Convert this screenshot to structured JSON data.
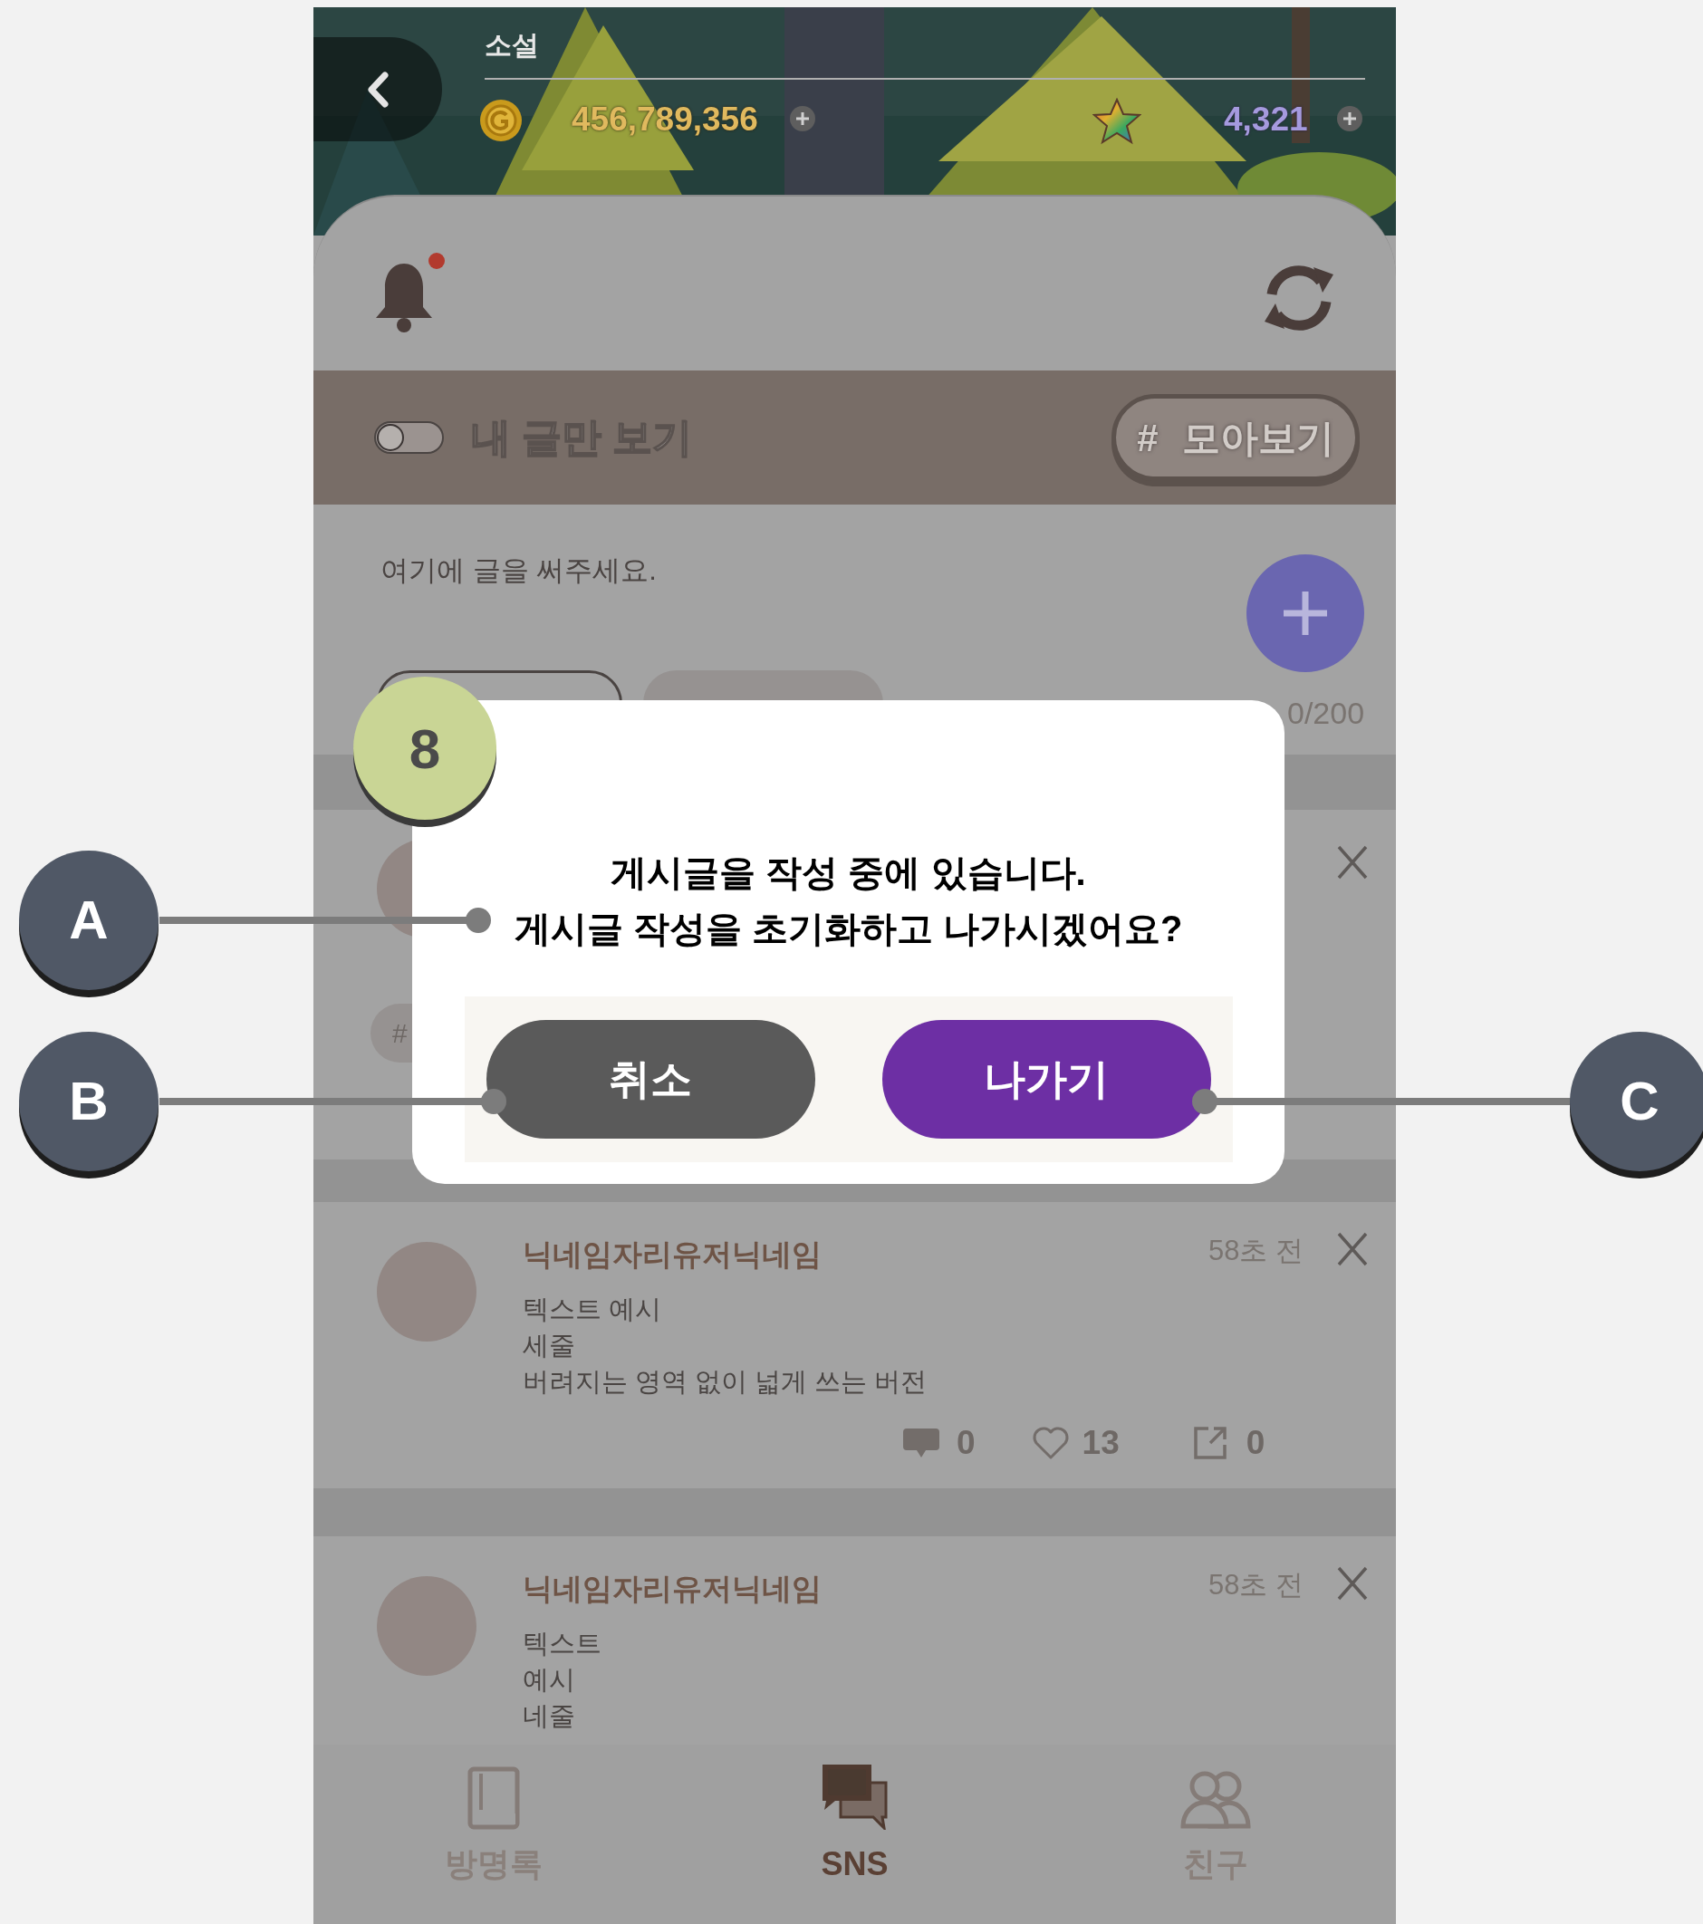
{
  "header": {
    "title": "소설",
    "gold": "456,789,356",
    "stars": "4,321"
  },
  "toolbar": {
    "notification_dot": true
  },
  "filter_bar": {
    "my_posts_only": {
      "label": "내 글만 보기",
      "on": false
    },
    "collect_button": {
      "hash": "#",
      "label": "모아보기"
    }
  },
  "composer": {
    "placeholder": "여기에 글을 써주세요.",
    "counter": "0/200"
  },
  "posts": [
    {
      "kind": "covered",
      "tag": "#"
    },
    {
      "kind": "full",
      "nickname": "닉네임자리유저닉네임",
      "time": "58초 전",
      "lines": [
        "텍스트 예시",
        "세줄",
        "버려지는 영역 없이 넓게 쓰는 버전"
      ],
      "comments": "0",
      "likes": "13",
      "shares": "0"
    },
    {
      "kind": "full",
      "nickname": "닉네임자리유저닉네임",
      "time": "58초 전",
      "lines": [
        "텍스트",
        "예시",
        "네줄"
      ]
    }
  ],
  "dialog": {
    "badge": "8",
    "lines": [
      "게시글을 작성 중에 있습니다.",
      "게시글 작성을 초기화하고 나가시겠어요?"
    ],
    "buttons": [
      {
        "label": "취소",
        "kind": "cancel"
      },
      {
        "label": "나가기",
        "kind": "confirm"
      }
    ]
  },
  "callouts": [
    {
      "label": "A"
    },
    {
      "label": "B"
    },
    {
      "label": "C"
    }
  ],
  "bottom_nav": [
    {
      "label": "방명록",
      "selected": false
    },
    {
      "label": "SNS",
      "selected": true
    },
    {
      "label": "친구",
      "selected": false
    }
  ]
}
